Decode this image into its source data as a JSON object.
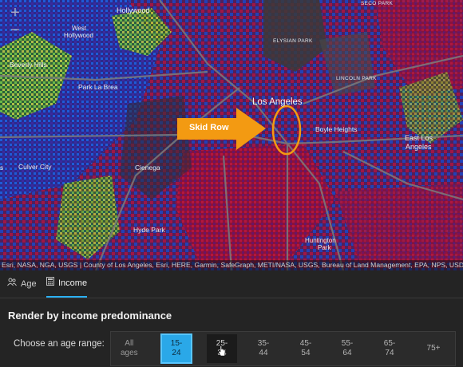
{
  "map": {
    "places": {
      "hollywood": "Hollywood",
      "west_hollywood_1": "West",
      "west_hollywood_2": "Hollywood",
      "beverly_hills": "Beverly Hills",
      "park_la_brea": "Park La Brea",
      "culver_city": "Culver City",
      "cienega": "Cienega",
      "hyde_park": "Hyde Park",
      "elysian_park": "ELYSIAN PARK",
      "lincoln_park": "LINCOLN PARK",
      "seco_park": "SECO PARK",
      "los_angeles": "Los Angeles",
      "boyle_heights": "Boyle Heights",
      "east_la_1": "East Los",
      "east_la_2": "Angeles",
      "huntington_park_1": "Huntington",
      "huntington_park_2": "Park",
      "edge_s": "s"
    },
    "callout_label": "Skid Row",
    "callout_color": "#f39a12",
    "zoom_in": "+",
    "zoom_out": "−",
    "attribution": "Esri, NASA, NGA, USGS | County of Los Angeles, Esri, HERE, Garmin, SafeGraph, METI/NASA, USGS, Bureau of Land Management, EPA, NPS, USDA"
  },
  "tabs": [
    {
      "label": "Age",
      "icon": "people-icon"
    },
    {
      "label": "Income",
      "icon": "calculator-icon",
      "selected": true
    }
  ],
  "panel": {
    "title": "Render by income predominance",
    "age_label": "Choose an age range:",
    "ranges": [
      {
        "line1": "All",
        "line2": "ages"
      },
      {
        "line1": "15-",
        "line2": "24",
        "selected": true
      },
      {
        "line1": "25-",
        "line2": "34",
        "hover": true
      },
      {
        "line1": "35-",
        "line2": "44"
      },
      {
        "line1": "45-",
        "line2": "54"
      },
      {
        "line1": "55-",
        "line2": "64"
      },
      {
        "line1": "65-",
        "line2": "74"
      },
      {
        "line1": "75+",
        "line2": ""
      }
    ]
  },
  "colors": {
    "accent": "#2aa8e8",
    "map_low": "#1e48c8",
    "map_high": "#b0133e",
    "map_mid": "#6a1670",
    "map_green": "#6cc630",
    "map_yellow": "#e8e63a"
  }
}
